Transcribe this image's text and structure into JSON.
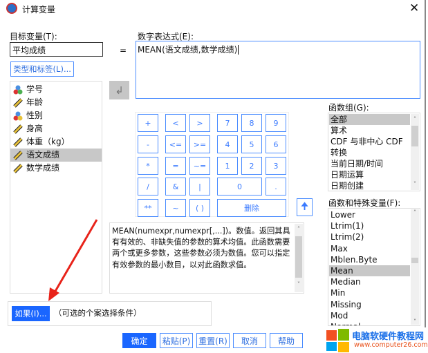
{
  "window": {
    "title": "计算变量"
  },
  "target": {
    "label": "目标变量(T):",
    "value": "平均成绩",
    "type_label_button": "类型和标签(L)..."
  },
  "equals": "=",
  "expression": {
    "label": "数字表达式(E):",
    "value": "MEAN(语文成绩,数学成绩)"
  },
  "variables": [
    {
      "name": "学号",
      "icon": "nominal-icon"
    },
    {
      "name": "年龄",
      "icon": "scale-ruler-icon"
    },
    {
      "name": "性别",
      "icon": "nominal-string-icon"
    },
    {
      "name": "身高",
      "icon": "scale-ruler-icon"
    },
    {
      "name": "体重（kg）",
      "icon": "scale-ruler-icon"
    },
    {
      "name": "语文成绩",
      "icon": "scale-ruler-icon",
      "selected": true
    },
    {
      "name": "数学成绩",
      "icon": "scale-ruler-icon"
    }
  ],
  "keypad": [
    [
      "+",
      "<",
      ">",
      "7",
      "8",
      "9"
    ],
    [
      "-",
      "<=",
      ">=",
      "4",
      "5",
      "6"
    ],
    [
      "*",
      "=",
      "~=",
      "1",
      "2",
      "3"
    ],
    [
      "/",
      "&",
      "|",
      "0",
      "."
    ],
    [
      "**",
      "~",
      "( )",
      "删除"
    ]
  ],
  "description": "MEAN(numexpr,numexpr[,...])。数值。返回其具有有效的、非缺失值的参数的算术均值。此函数需要两个或更多参数，这些参数必须为数值。您可以指定有效参数的最小数目，以对此函数求值。",
  "function_group": {
    "label": "函数组(G):",
    "items": [
      "全部",
      "算术",
      "CDF 与非中心 CDF",
      "转换",
      "当前日期/时间",
      "日期运算",
      "日期创建"
    ],
    "selected": "全部"
  },
  "functions": {
    "label": "函数和特殊变量(F):",
    "items": [
      "Lower",
      "Ltrim(1)",
      "Ltrim(2)",
      "Max",
      "Mblen.Byte",
      "Mean",
      "Median",
      "Min",
      "Missing",
      "Mod",
      "Normal"
    ],
    "selected": "Mean"
  },
  "if_button": "如果(I)...",
  "if_note": "（可选的个案选择条件）",
  "buttons": {
    "ok": "确定",
    "paste": "粘贴(P)",
    "reset": "重置(R)",
    "cancel": "取消",
    "help": "帮助"
  },
  "watermark": {
    "title": "电脑软硬件教程网",
    "url": "www.computer26.com"
  },
  "colors": {
    "accent": "#1a66ff",
    "arrow": "#e8231a"
  }
}
